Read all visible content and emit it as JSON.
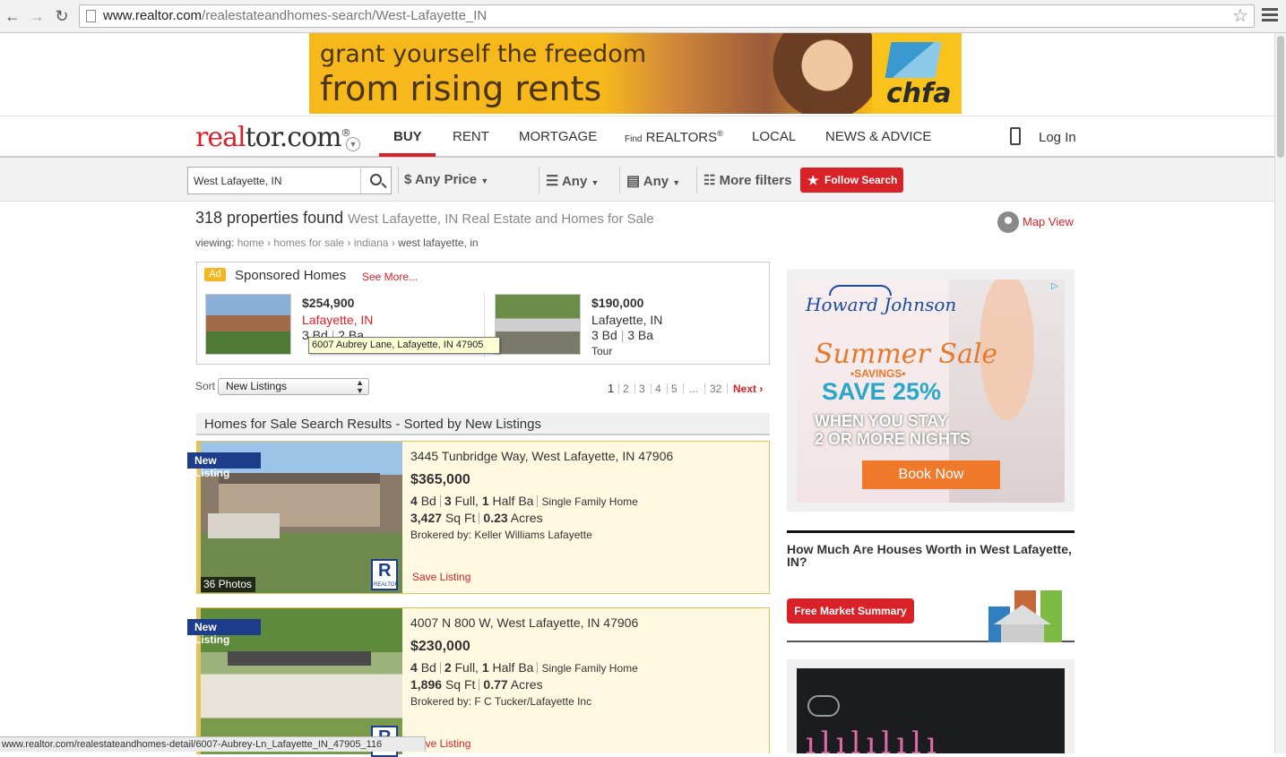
{
  "browser": {
    "url_host": "www.realtor.com",
    "url_path": "/realestateandhomes-search/West-Lafayette_IN",
    "back_icon": "back-arrow-icon",
    "forward_icon": "forward-arrow-icon",
    "reload_icon": "reload-icon",
    "status_url": "www.realtor.com/realestateandhomes-detail/6007-Aubrey-Ln_Lafayette_IN_47905_116"
  },
  "top_ad": {
    "line1": "grant yourself the freedom",
    "line2": "from rising rents",
    "brand": "chfa"
  },
  "header": {
    "logo_red": "real",
    "logo_dark": "tor.com",
    "logo_mark": "®",
    "nav": [
      {
        "label": "BUY",
        "active": true
      },
      {
        "label": "RENT"
      },
      {
        "label": "MORTGAGE"
      },
      {
        "label_small": "Find",
        "label": "REALTORS",
        "sup": "®"
      },
      {
        "label": "LOCAL"
      },
      {
        "label": "NEWS & ADVICE"
      }
    ],
    "login": "Log In"
  },
  "search": {
    "value": "West Lafayette, IN",
    "price": "Any Price",
    "beds": "Any",
    "baths": "Any",
    "more_filters": "More filters",
    "follow": "Follow Search"
  },
  "results": {
    "count_text": "318 properties found",
    "subtitle": "West Lafayette, IN Real Estate and Homes for Sale",
    "map_view": "Map View",
    "breadcrumb": {
      "label": "viewing:",
      "items": [
        "home",
        "homes for sale",
        "indiana",
        "west lafayette, in"
      ]
    }
  },
  "sponsored": {
    "badge": "Ad",
    "title": "Sponsored Homes",
    "see_more": "See More...",
    "cards": [
      {
        "price": "$254,900",
        "location": "Lafayette, IN",
        "beds": "3 Bd",
        "baths": "2 Ba"
      },
      {
        "price": "$190,000",
        "location": "Lafayette, IN",
        "beds": "3 Bd",
        "baths": "3 Ba",
        "extra": "Tour"
      }
    ],
    "tooltip": "6007 Aubrey Lane, Lafayette, IN 47905"
  },
  "sort": {
    "label": "Sort",
    "value": "New Listings"
  },
  "pagination": {
    "pages": [
      "1",
      "2",
      "3",
      "4",
      "5",
      "...",
      "32"
    ],
    "next": "Next ›"
  },
  "list_header": "Homes for Sale Search Results - Sorted by New Listings",
  "listings": [
    {
      "badge": "New Listing",
      "address": "3445 Tunbridge Way, West Lafayette, IN 47906",
      "price": "$365,000",
      "beds": "4",
      "beds_unit": "Bd",
      "full_baths": "3",
      "full_unit": "Full,",
      "half_baths": "1",
      "half_unit": "Half Ba",
      "type": "Single Family Home",
      "sqft": "3,427",
      "sqft_unit": "Sq Ft",
      "acres": "0.23",
      "acres_unit": "Acres",
      "broker": "Brokered by: Keller Williams Lafayette",
      "photos": "36 Photos",
      "save": "Save Listing",
      "realtor_mark": "R",
      "realtor_small": "REALTOR"
    },
    {
      "badge": "New Listing",
      "address": "4007 N 800 W, West Lafayette, IN 47906",
      "price": "$230,000",
      "beds": "4",
      "beds_unit": "Bd",
      "full_baths": "2",
      "full_unit": "Full,",
      "half_baths": "1",
      "half_unit": "Half Ba",
      "type": "Single Family Home",
      "sqft": "1,896",
      "sqft_unit": "Sq Ft",
      "acres": "0.77",
      "acres_unit": "Acres",
      "broker": "Brokered by: F C Tucker/Lafayette Inc",
      "save": "Save Listing",
      "realtor_mark": "R"
    }
  ],
  "side_ad": {
    "brand": "Howard Johnson",
    "headline": "Summer Sale",
    "savings": "•SAVINGS•",
    "save": "SAVE 25%",
    "when1": "WHEN YOU STAY",
    "when2": "2 OR MORE NIGHTS",
    "cta": "Book Now"
  },
  "worth": {
    "title": "How Much Are Houses Worth in West Lafayette, IN?",
    "button": "Free Market Summary"
  },
  "colors": {
    "brand_red": "#d92228",
    "badge_blue": "#1d3c8c",
    "listing_bg": "#fff9e2"
  }
}
